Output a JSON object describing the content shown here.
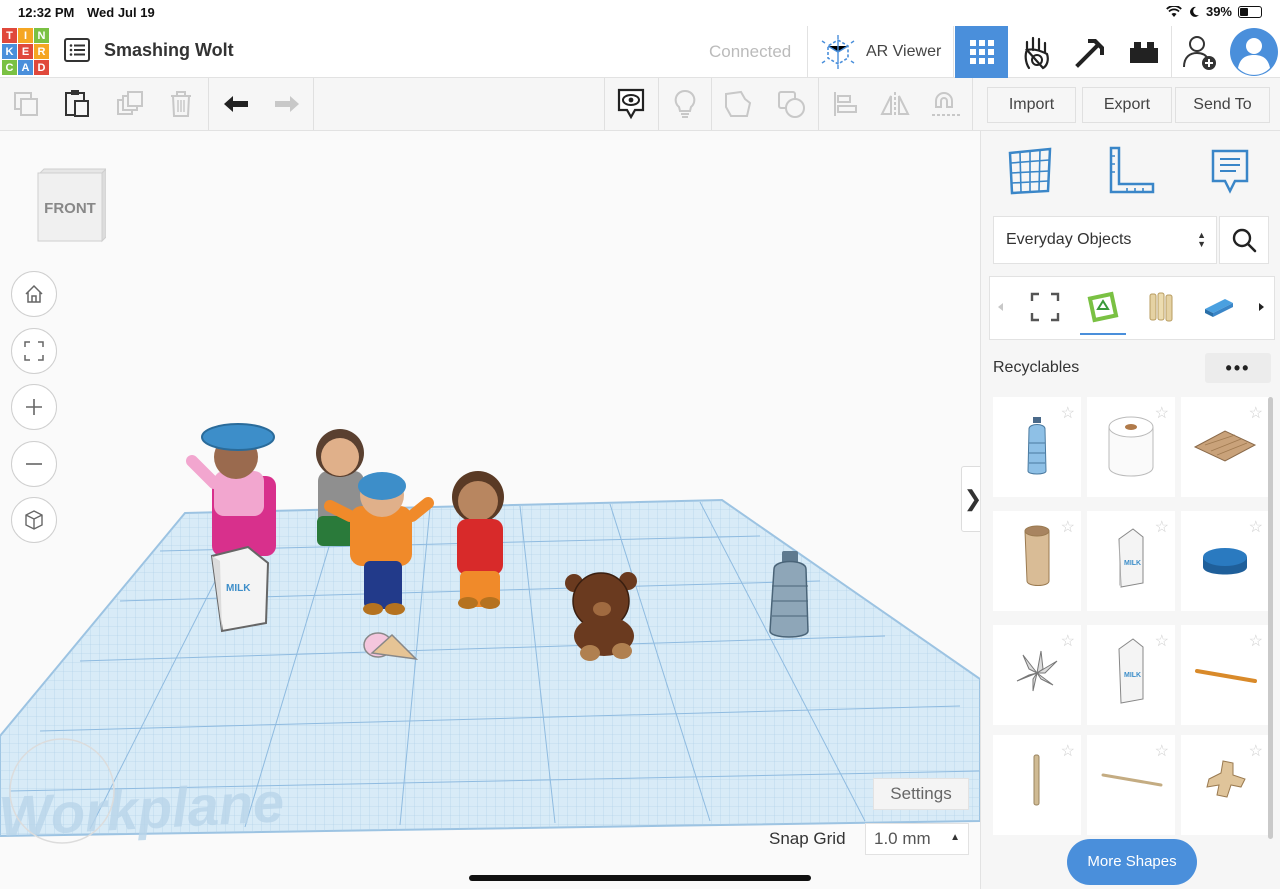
{
  "status_bar": {
    "time": "12:32 PM",
    "date": "Wed Jul 19",
    "battery": "39%"
  },
  "topbar": {
    "logo_letters": [
      "T",
      "I",
      "N",
      "K",
      "E",
      "R",
      "C",
      "A",
      "D"
    ],
    "logo_colors": [
      "#e0483b",
      "#f5a623",
      "#7ac143",
      "#4a8fdb",
      "#e0483b",
      "#f5a623",
      "#7ac143",
      "#4a8fdb",
      "#e0483b"
    ],
    "design_name": "Smashing Wolt",
    "status": "Connected",
    "ar_viewer": "AR Viewer",
    "icons": [
      "grid-view-icon",
      "hand-icon",
      "pickaxe-icon",
      "brick-icon",
      "add-user-icon",
      "avatar"
    ]
  },
  "toolbar": {
    "import_label": "Import",
    "export_label": "Export",
    "send_to_label": "Send To",
    "tools": [
      "copy-icon",
      "paste-icon",
      "duplicate-icon",
      "delete-icon",
      "undo-icon",
      "redo-icon",
      "notes-toggle-icon",
      "light-bulb-icon",
      "group-icon",
      "ungroup-icon",
      "align-icon",
      "mirror-icon",
      "workplane-magnet-icon"
    ]
  },
  "viewport": {
    "view_cube_label": "FRONT",
    "workplane_watermark": "Workplane",
    "settings_label": "Settings",
    "snap_grid_label": "Snap Grid",
    "snap_grid_value": "1.0 mm",
    "panel_toggle": "❯"
  },
  "sidebar": {
    "top_icons": [
      "workplane-icon",
      "ruler-icon",
      "notes-icon"
    ],
    "category": "Everyday Objects",
    "section_title": "Recyclables",
    "more_label": "•••",
    "more_shapes_label": "More Shapes",
    "shapes": [
      {
        "name": "water-bottle"
      },
      {
        "name": "toilet-paper-roll"
      },
      {
        "name": "cardboard-sheet"
      },
      {
        "name": "paper-tube"
      },
      {
        "name": "milk-carton"
      },
      {
        "name": "blue-lid"
      },
      {
        "name": "paper-fan"
      },
      {
        "name": "milk-carton-2"
      },
      {
        "name": "wooden-stick"
      },
      {
        "name": "popsicle-stick"
      },
      {
        "name": "skewer"
      },
      {
        "name": "cardboard-cross"
      }
    ]
  },
  "accent_color": "#4a8fdb"
}
